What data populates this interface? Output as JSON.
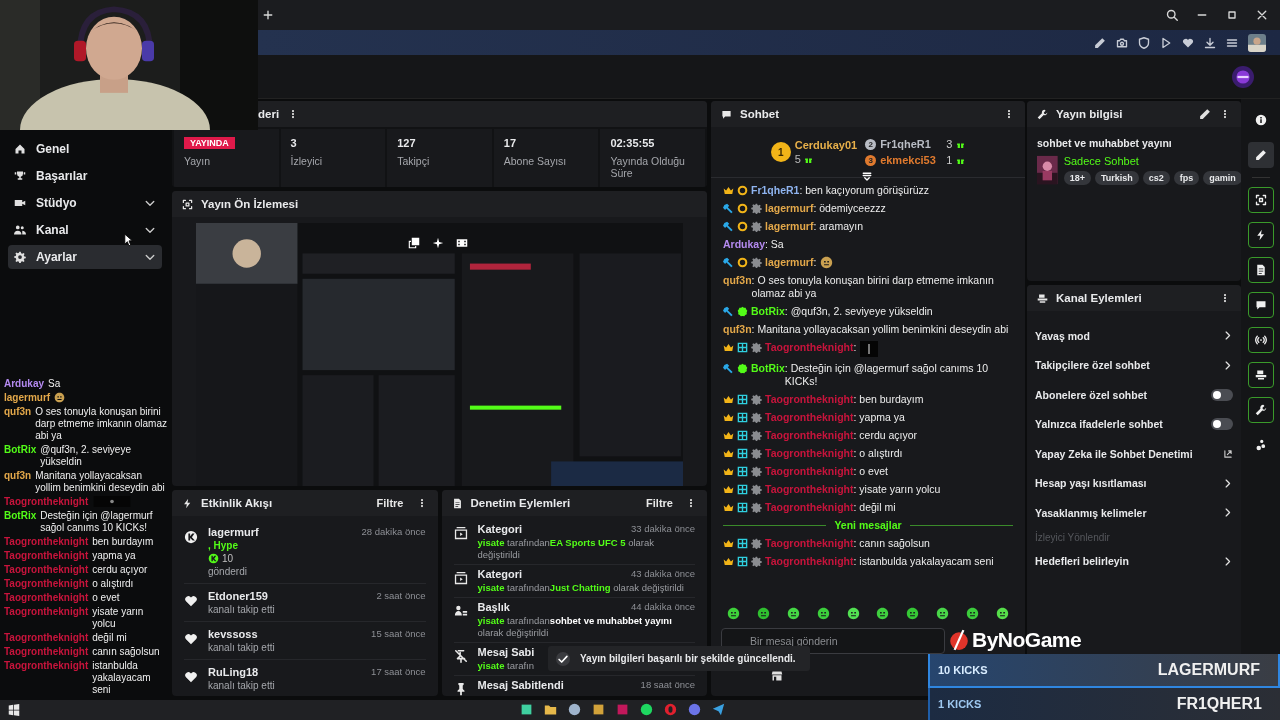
{
  "sidebar": {
    "items": [
      {
        "kind": "home",
        "label": "Genel",
        "selected": false,
        "expandable": false
      },
      {
        "kind": "trophy",
        "label": "Başarılar",
        "selected": false,
        "expandable": false
      },
      {
        "kind": "studio",
        "label": "Stüdyo",
        "selected": false,
        "expandable": true
      },
      {
        "kind": "channel",
        "label": "Kanal",
        "selected": false,
        "expandable": true
      },
      {
        "kind": "settings",
        "label": "Ayarlar",
        "selected": true,
        "expandable": true
      }
    ]
  },
  "overlay_chat": [
    {
      "name": "Ardukay",
      "color": "#b48af0",
      "text": "Sa"
    },
    {
      "kind": "emote",
      "name": "lagermurf",
      "color": "#e3a84a"
    },
    {
      "name": "quf3n",
      "color": "#e3a84a",
      "text": "O ses tonuyla konuşan birini darp etmeme imkanın olamaz abi ya"
    },
    {
      "name": "BotRix",
      "color": "#53fc18",
      "text": "@quf3n, 2. seviyeye yükseldin"
    },
    {
      "name": "quf3n",
      "color": "#e3a84a",
      "text": "Manitana yollayacaksan yollim benimkini deseydin abi"
    },
    {
      "name": "Taogrontheknight",
      "color": "#c8143c"
    },
    {
      "name": "BotRix",
      "color": "#53fc18",
      "text": "Desteğin için @lagermurf sağol canıms 10 KICKs!"
    },
    {
      "name": "Taogrontheknight",
      "color": "#c8143c",
      "text": "ben burdayım"
    },
    {
      "name": "Taogrontheknight",
      "color": "#c8143c",
      "text": "yapma ya"
    },
    {
      "name": "Taogrontheknight",
      "color": "#c8143c",
      "text": "cerdu açıyor"
    },
    {
      "name": "Taogrontheknight",
      "color": "#c8143c",
      "text": "o alıştırdı"
    },
    {
      "name": "Taogrontheknight",
      "color": "#c8143c",
      "text": "o evet"
    },
    {
      "name": "Taogrontheknight",
      "color": "#c8143c",
      "text": "yisate yarın yolcu"
    },
    {
      "name": "Taogrontheknight",
      "color": "#c8143c",
      "text": "değil mi"
    },
    {
      "name": "Taogrontheknight",
      "color": "#c8143c",
      "text": "canın sağolsun"
    },
    {
      "name": "Taogrontheknight",
      "color": "#c8143c",
      "text": "istanbulda yakalayacam seni"
    }
  ],
  "stats_panel": {
    "title": "deri",
    "stats": [
      {
        "kind": "live",
        "value": "YAYINDA",
        "label": "Yayın"
      },
      {
        "kind": "number",
        "value": "3",
        "label": "İzleyici"
      },
      {
        "kind": "number",
        "value": "127",
        "label": "Takipçi"
      },
      {
        "kind": "number",
        "value": "17",
        "label": "Abone Sayısı"
      },
      {
        "kind": "number",
        "value": "02:35:55",
        "label": "Yayında Olduğu Süre"
      }
    ]
  },
  "preview": {
    "title": "Yayın Ön İzlemesi"
  },
  "activity": {
    "title": "Etkinlik Akışı",
    "filter": "Filtre",
    "items": [
      {
        "kind": "kicks",
        "name": "lagermurf",
        "time": "28 dakika önce",
        "reward": ", Hype",
        "amount": "10",
        "detail": "gönderdi"
      },
      {
        "kind": "follow",
        "name": "Etdoner159",
        "time": "2 saat önce",
        "detail": "kanalı takip etti"
      },
      {
        "kind": "follow",
        "name": "kevssoss",
        "time": "15 saat önce",
        "detail": "kanalı takip etti"
      },
      {
        "kind": "follow",
        "name": "RuLing18",
        "time": "17 saat önce",
        "detail": "kanalı takip etti"
      }
    ]
  },
  "moderation": {
    "title": "Denetim Eylemleri",
    "filter": "Filtre",
    "items": [
      {
        "kind": "category",
        "title": "Kategori",
        "time": "33 dakika önce",
        "actor": "yisate",
        "via": "tarafından",
        "value": "EA Sports UFC 5",
        "suffix": "olarak değiştirildi"
      },
      {
        "kind": "category",
        "title": "Kategori",
        "time": "43 dakika önce",
        "actor": "yisate",
        "via": "tarafından",
        "value": "Just Chatting",
        "suffix": "olarak değiştirildi"
      },
      {
        "kind": "title",
        "title": "Başlık",
        "time": "44 dakika önce",
        "actor": "yisate",
        "via": "tarafından",
        "value": "sohbet ve muhabbet yayını",
        "suffix": "olarak değiştirildi"
      },
      {
        "kind": "unpin",
        "title": "Mesaj Sabi",
        "actor": "yisate",
        "via": "tarafın"
      },
      {
        "kind": "pin",
        "title": "Mesaj Sabitlendi",
        "time": "18 saat önce"
      }
    ]
  },
  "chat": {
    "title": "Sohbet",
    "leaders": [
      {
        "rank": "1",
        "name": "Cerdukay01",
        "count": "5",
        "color": "#e8b04a"
      },
      {
        "rank": "2",
        "name": "Fr1qheR1",
        "count": "3",
        "color": "#b8bcc4"
      },
      {
        "rank": "3",
        "name": "ekmekci53",
        "count": "1",
        "color": "#e07a2e"
      }
    ],
    "messages": [
      {
        "badges": [
          {
            "kind": "crown"
          },
          {
            "kind": "sub"
          }
        ],
        "name": "Fr1qheR1",
        "color": "#8fb4f0",
        "text": ": ben kaçıyorum görüşürüzz"
      },
      {
        "badges": [
          {
            "kind": "mod"
          },
          {
            "kind": "sub"
          },
          {
            "kind": "gear"
          }
        ],
        "name": "lagermurf",
        "color": "#e3a84a",
        "text": ": ödemiyceezzz"
      },
      {
        "badges": [
          {
            "kind": "mod"
          },
          {
            "kind": "sub"
          },
          {
            "kind": "gear"
          }
        ],
        "name": "lagermurf",
        "color": "#e3a84a",
        "text": ": aramayın"
      },
      {
        "name": "Ardukay",
        "color": "#b48af0",
        "text": ": Sa"
      },
      {
        "badges": [
          {
            "kind": "mod"
          },
          {
            "kind": "sub"
          },
          {
            "kind": "gear"
          }
        ],
        "kind": "emote",
        "name": "lagermurf",
        "color": "#e3a84a",
        "text": ":"
      },
      {
        "name": "quf3n",
        "color": "#e3a84a",
        "text": ": O ses tonuyla konuşan birini darp etmeme imkanın olamaz abi ya"
      },
      {
        "badges": [
          {
            "kind": "mod"
          },
          {
            "kind": "verified"
          }
        ],
        "name": "BotRix",
        "color": "#53fc18",
        "text": ": @quf3n, 2. seviyeye yükseldin"
      },
      {
        "name": "quf3n",
        "color": "#e3a84a",
        "text": ": Manitana yollayacaksan yollim benimkini deseydin abi"
      },
      {
        "badges": [
          {
            "kind": "crown"
          },
          {
            "kind": "bg"
          },
          {
            "kind": "gear"
          }
        ],
        "name": "Taogrontheknight",
        "color": "#c8143c",
        "text": ":"
      },
      {
        "badges": [
          {
            "kind": "mod"
          },
          {
            "kind": "verified"
          }
        ],
        "name": "BotRix",
        "color": "#53fc18",
        "text": ": Desteğin için @lagermurf sağol canıms 10 KICKs!"
      },
      {
        "badges": [
          {
            "kind": "crown"
          },
          {
            "kind": "bg"
          },
          {
            "kind": "gear"
          }
        ],
        "name": "Taogrontheknight",
        "color": "#c8143c",
        "text": ": ben burdayım"
      },
      {
        "badges": [
          {
            "kind": "crown"
          },
          {
            "kind": "bg"
          },
          {
            "kind": "gear"
          }
        ],
        "name": "Taogrontheknight",
        "color": "#c8143c",
        "text": ": yapma ya"
      },
      {
        "badges": [
          {
            "kind": "crown"
          },
          {
            "kind": "bg"
          },
          {
            "kind": "gear"
          }
        ],
        "name": "Taogrontheknight",
        "color": "#c8143c",
        "text": ": cerdu açıyor"
      },
      {
        "badges": [
          {
            "kind": "crown"
          },
          {
            "kind": "bg"
          },
          {
            "kind": "gear"
          }
        ],
        "name": "Taogrontheknight",
        "color": "#c8143c",
        "text": ": o alıştırdı"
      },
      {
        "badges": [
          {
            "kind": "crown"
          },
          {
            "kind": "bg"
          },
          {
            "kind": "gear"
          }
        ],
        "name": "Taogrontheknight",
        "color": "#c8143c",
        "text": ": o evet"
      },
      {
        "badges": [
          {
            "kind": "crown"
          },
          {
            "kind": "bg"
          },
          {
            "kind": "gear"
          }
        ],
        "name": "Taogrontheknight",
        "color": "#c8143c",
        "text": ": yisate yarın yolcu"
      },
      {
        "badges": [
          {
            "kind": "crown"
          },
          {
            "kind": "bg"
          },
          {
            "kind": "gear"
          }
        ],
        "name": "Taogrontheknight",
        "color": "#c8143c",
        "text": ": değil mi"
      }
    ],
    "divider": "Yeni mesajlar",
    "new_messages": [
      {
        "badges": [
          {
            "kind": "crown"
          },
          {
            "kind": "bg"
          },
          {
            "kind": "gear"
          }
        ],
        "name": "Taogrontheknight",
        "color": "#c8143c",
        "text": ": canın sağolsun"
      },
      {
        "badges": [
          {
            "kind": "crown"
          },
          {
            "kind": "bg"
          },
          {
            "kind": "gear"
          }
        ],
        "name": "Taogrontheknight",
        "color": "#c8143c",
        "text": ": istanbulda yakalayacam seni"
      }
    ],
    "placeholder": "Bir mesaj gönderin"
  },
  "stream_info": {
    "title": "Yayın bilgisi",
    "stream_title": "sohbet ve muhabbet yayını",
    "category": "Sadece Sohbet",
    "tags": [
      "18+",
      "Turkish",
      "cs2",
      "fps",
      "gamin"
    ]
  },
  "channel_actions": {
    "title": "Kanal Eylemleri",
    "items": [
      {
        "kind": "link",
        "label": "Yavaş mod"
      },
      {
        "kind": "link",
        "label": "Takipçilere özel sohbet"
      },
      {
        "kind": "toggle",
        "label": "Abonelere özel sohbet",
        "on": false
      },
      {
        "kind": "toggle",
        "label": "Yalnızca ifadelerle sohbet",
        "on": false
      },
      {
        "kind": "external",
        "label": "Yapay Zeka ile Sohbet Denetimi"
      },
      {
        "kind": "link",
        "label": "Hesap yaşı kısıtlaması"
      },
      {
        "kind": "link",
        "label": "Yasaklanmış kelimeler"
      },
      {
        "kind": "section",
        "label": "İzleyici Yönlendir"
      },
      {
        "kind": "link",
        "label": "Hedefleri belirleyin"
      }
    ]
  },
  "rail": [
    {
      "kind": "info",
      "selected": false,
      "pinned": false
    },
    {
      "kind": "pencil",
      "selected": true,
      "pinned": false
    },
    {
      "kind": "preview",
      "selected": false,
      "pinned": true
    },
    {
      "kind": "bolt",
      "selected": false,
      "pinned": true
    },
    {
      "kind": "doc",
      "selected": false,
      "pinned": true
    },
    {
      "kind": "chat",
      "selected": false,
      "pinned": true
    },
    {
      "kind": "broadcast",
      "selected": false,
      "pinned": true
    },
    {
      "kind": "camera2",
      "selected": false,
      "pinned": true
    },
    {
      "kind": "wrench",
      "selected": false,
      "pinned": true
    },
    {
      "kind": "bubbles",
      "selected": false,
      "pinned": false
    }
  ],
  "toast": {
    "text": "Yayın bilgileri başarılı bir şekilde güncellendi."
  },
  "kicks_overlay": {
    "logo": "ByNoGame",
    "rows": [
      {
        "amount": "10 KICKS",
        "name": "LAGERMURF",
        "top": true
      },
      {
        "amount": "1 KICKS",
        "name": "FR1QHER1",
        "top": false
      }
    ]
  }
}
